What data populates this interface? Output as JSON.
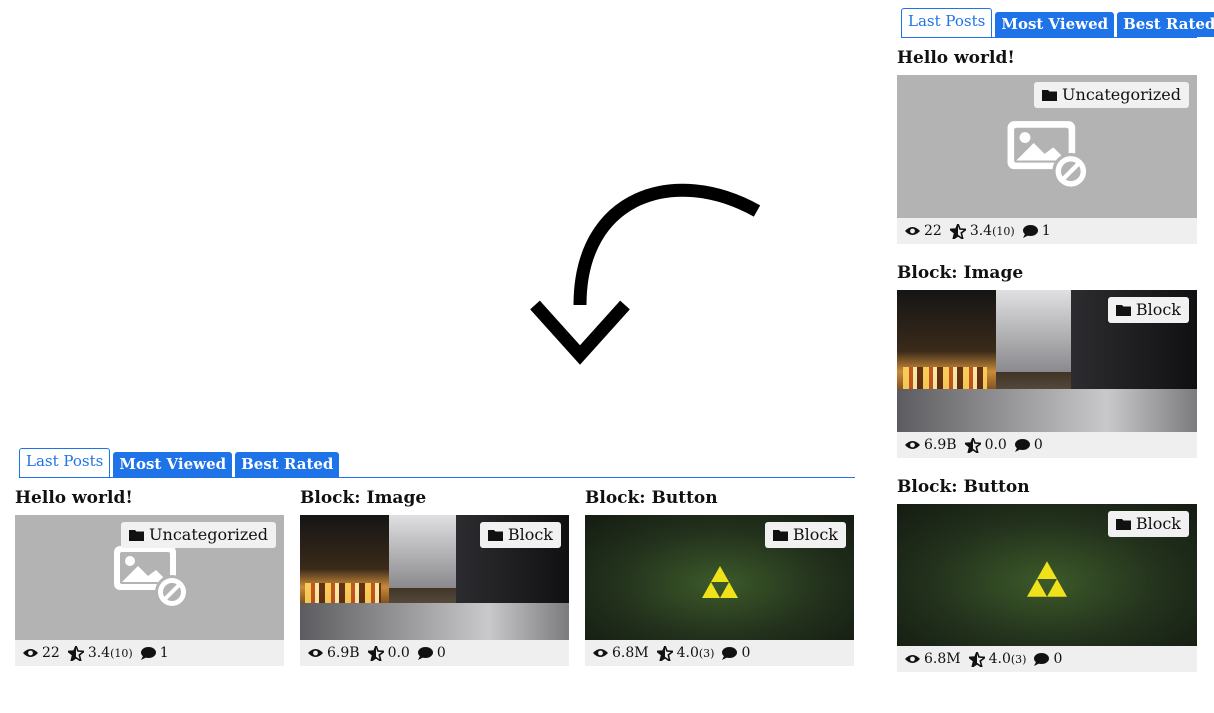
{
  "tabs": {
    "last_posts": "Last Posts",
    "most_viewed": "Most Viewed",
    "best_rated": "Best Rated"
  },
  "posts": [
    {
      "title": "Hello world!",
      "category": "Uncategorized",
      "views": "22",
      "rating": "3.4",
      "rating_count": "(10)",
      "comments": "1",
      "thumbnail": "placeholder-image-icon"
    },
    {
      "title": "Block: Image",
      "category": "Block",
      "views": "6.9B",
      "rating": "0.0",
      "rating_count": "",
      "comments": "0",
      "thumbnail": "city-night-street-photo"
    },
    {
      "title": "Block: Button",
      "category": "Block",
      "views": "6.8M",
      "rating": "4.0",
      "rating_count": "(3)",
      "comments": "0",
      "thumbnail": "glowing-triforce-photo"
    }
  ],
  "colors": {
    "accent": "#1e73e8",
    "meta_bg": "#efefef",
    "placeholder_bg": "#b3b3b3"
  }
}
